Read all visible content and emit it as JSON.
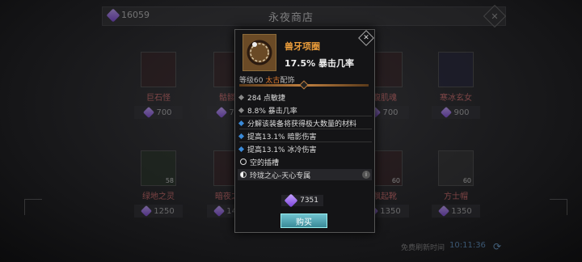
{
  "shop": {
    "title": "永夜商店",
    "currency": "16059",
    "refresh_label": "免费刷新时间",
    "refresh_time": "10:11:36"
  },
  "slots": [
    {
      "name": "巨石怪",
      "price": "700",
      "color": "#c65a5a"
    },
    {
      "name": "骷髅脸",
      "price": "700",
      "color": "#c65a5a"
    },
    {
      "name": "腹肌魂",
      "price": "700",
      "color": "#c65a5a"
    },
    {
      "name": "寒冰玄女",
      "price": "900",
      "color": "#c65a5a"
    },
    {
      "name": "绿地之灵",
      "price": "1250",
      "badge": "58",
      "color": "#c65a5a"
    },
    {
      "name": "暗夜之翼",
      "price": "1400",
      "color": "#c65a5a"
    },
    {
      "name": "飘起靴",
      "price": "1350",
      "badge": "60",
      "color": "#c65a5a"
    },
    {
      "name": "方士帽",
      "price": "1350",
      "badge": "60",
      "color": "#c65a5a"
    }
  ],
  "tooltip": {
    "item_name": "兽牙项圈",
    "item_stat": "17.5% 暴击几率",
    "level": "等级60",
    "rarity": "太古",
    "slot_type": "配饰",
    "lines": [
      {
        "text": "284 点敏捷",
        "bullet": "grey"
      },
      {
        "text": "8.8% 暴击几率",
        "bullet": "grey"
      },
      {
        "text": "分解该装备将获得极大数量的材料",
        "bullet": "blue"
      },
      {
        "text": "提高13.1% 暗影伤害",
        "bullet": "blue"
      },
      {
        "text": "提高13.1% 冰冷伤害",
        "bullet": "blue"
      }
    ],
    "socket": "空的插槽",
    "unique": "玲珑之心-天心专属",
    "price": "7351",
    "buy_label": "购买",
    "colors": {
      "name": "#e89b3a",
      "ancient": "#e07a2e",
      "buy": "#4fa6b4"
    }
  }
}
